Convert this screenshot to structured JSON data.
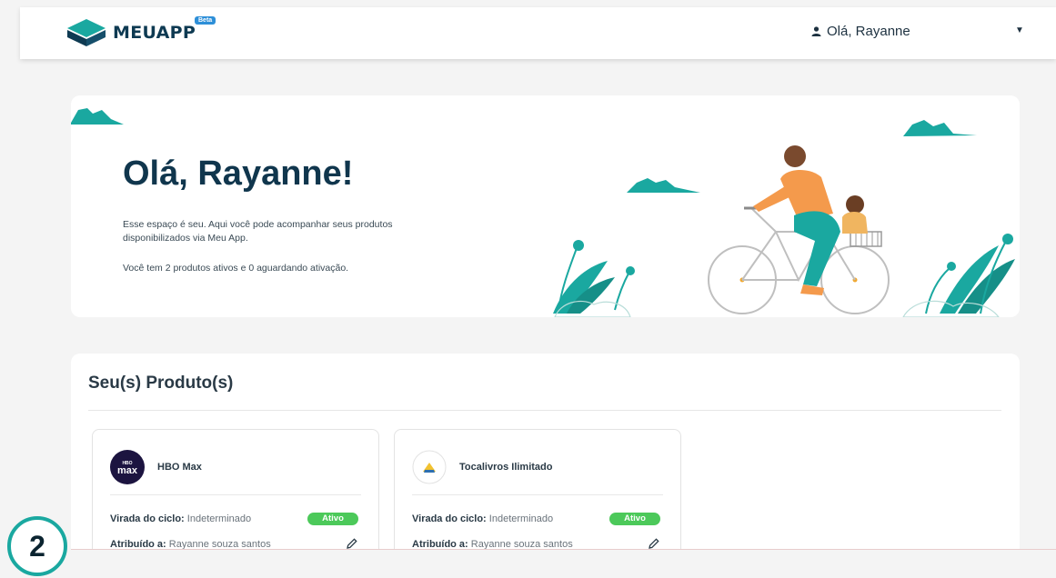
{
  "navbar": {
    "logo_text": "MEUAPP",
    "beta_label": "Beta",
    "user_greeting": "Olá, Rayanne",
    "icons": {
      "user": "person-icon",
      "menu": "caret-down-icon"
    }
  },
  "hero": {
    "title": "Olá, Rayanne!",
    "description": "Esse espaço é seu. Aqui você pode acompanhar seus produtos disponibilizados via Meu App.",
    "status": "Você tem 2 produtos ativos e 0 aguardando ativação."
  },
  "products": {
    "title": "Seu(s) Produto(s)",
    "items": [
      {
        "name": "HBO Max",
        "logo_text": "max",
        "cycle_label": "Virada do ciclo:",
        "cycle_value": "Indeterminado",
        "status": "Ativo",
        "assigned_label": "Atribuído a:",
        "assigned_value": "Rayanne souza santos"
      },
      {
        "name": "Tocalivros Ilimitado",
        "cycle_label": "Virada do ciclo:",
        "cycle_value": "Indeterminado",
        "status": "Ativo",
        "assigned_label": "Atribuído a:",
        "assigned_value": "Rayanne souza santos"
      }
    ]
  },
  "step_number": "2",
  "colors": {
    "accent_teal": "#1aa8a0",
    "status_green": "#4cc95a",
    "navy": "#10364d"
  }
}
